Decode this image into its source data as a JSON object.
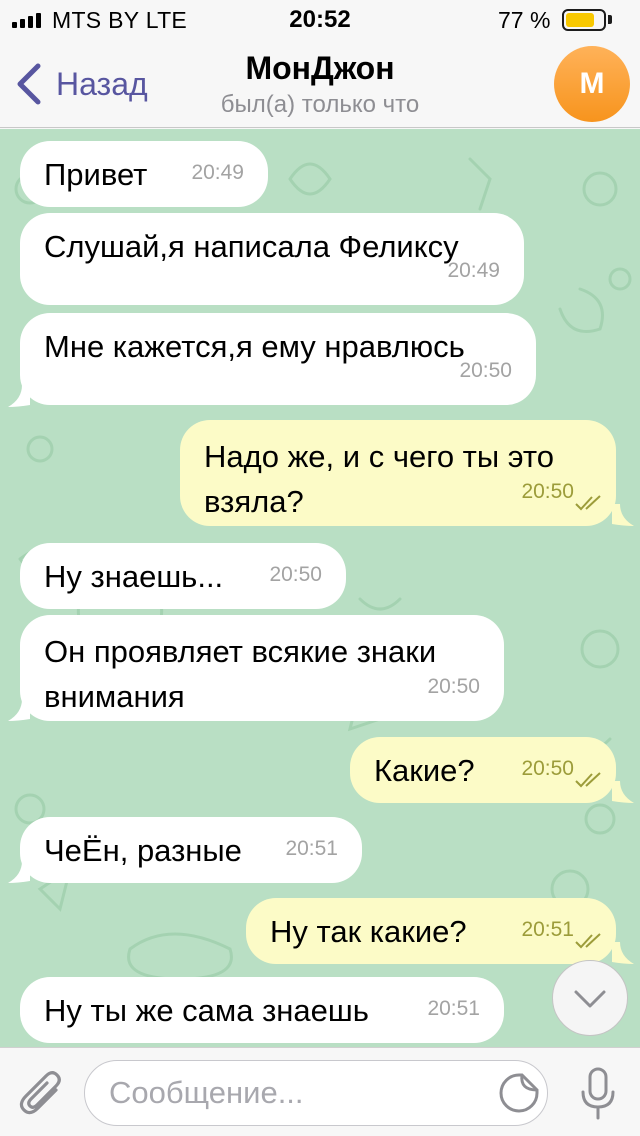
{
  "status_bar": {
    "carrier": "MTS BY   LTE",
    "time": "20:52",
    "battery_percent": "77 %",
    "battery_level": 0.77,
    "battery_color": "#f8c800"
  },
  "nav": {
    "back_label": "Назад",
    "title": "МонДжон",
    "subtitle": "был(а) только что",
    "avatar_initial": "М",
    "accent_color": "#5856a0"
  },
  "messages": [
    {
      "direction": "in",
      "text": "Привет",
      "time": "20:49"
    },
    {
      "direction": "in",
      "text": "Слушай,я написала Феликсу",
      "time": "20:49"
    },
    {
      "direction": "in",
      "text": "Мне кажется,я ему нравлюсь",
      "time": "20:50"
    },
    {
      "direction": "out",
      "text_lines": [
        "Надо же, и с чего ты это",
        "взяла?"
      ],
      "time": "20:50",
      "read": true
    },
    {
      "direction": "in",
      "text": "Ну знаешь...",
      "time": "20:50"
    },
    {
      "direction": "in",
      "text_lines": [
        "Он проявляет всякие знаки",
        "внимания"
      ],
      "time": "20:50"
    },
    {
      "direction": "out",
      "text": "Какие?",
      "time": "20:50",
      "read": true
    },
    {
      "direction": "in",
      "text": "ЧеЁн, разные",
      "time": "20:51"
    },
    {
      "direction": "out",
      "text": "Ну так какие?",
      "time": "20:51",
      "read": true
    },
    {
      "direction": "in",
      "text": "Ну ты же сама знаешь",
      "time": "20:51"
    }
  ],
  "input": {
    "placeholder": "Сообщение..."
  },
  "icons": {
    "back": "chevron-left-icon",
    "attach": "paperclip-icon",
    "sticker": "sticker-icon",
    "mic": "microphone-icon",
    "scroll": "chevron-down-icon",
    "read": "double-check-icon"
  },
  "colors": {
    "chat_background": "#b9dfc4",
    "incoming_bubble": "#ffffff",
    "outgoing_bubble": "#fcfbc7"
  }
}
